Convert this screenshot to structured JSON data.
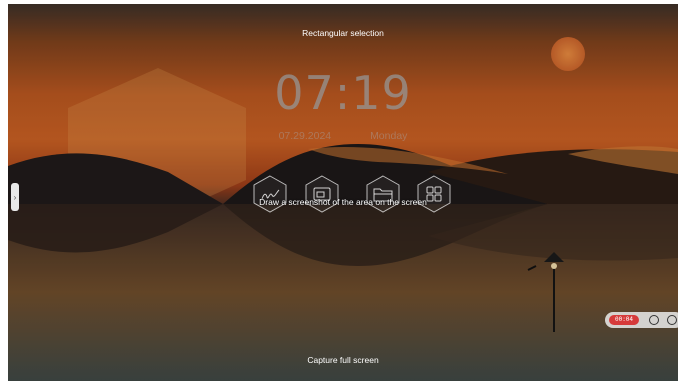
{
  "overlay": {
    "top_label": "Rectangular selection",
    "bottom_label": "Capture full screen",
    "hint": "Draw a screenshot of the area on the screen"
  },
  "clock": {
    "time": "07:19",
    "date": "07.29.2024",
    "weekday": "Monday"
  },
  "tools": [
    {
      "name": "annotate-icon"
    },
    {
      "name": "screen-icon"
    },
    {
      "name": "folder-icon"
    },
    {
      "name": "apps-grid-icon"
    }
  ],
  "recorder": {
    "timer": "00:04"
  },
  "colors": {
    "sky": "#c25d22",
    "sun": "#d8742e",
    "timer": "#d63a3a"
  }
}
